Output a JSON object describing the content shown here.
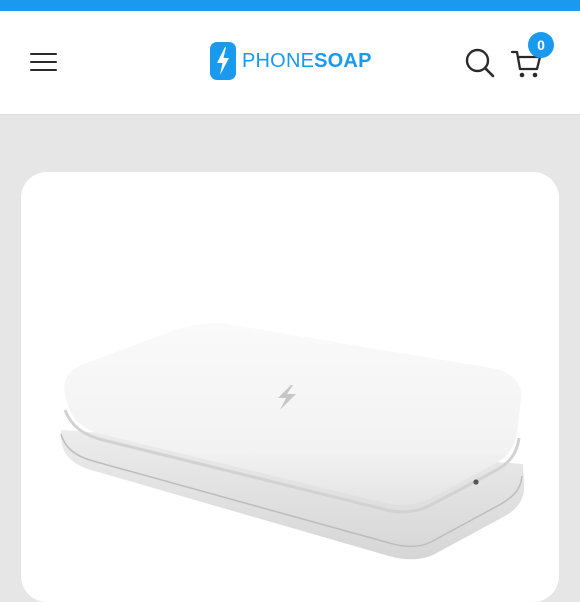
{
  "header": {
    "logo": {
      "text_light": "PHONE",
      "text_bold": "SOAP",
      "icon": "lightning-bolt-icon",
      "color": "#1a9aef"
    },
    "menu_icon": "hamburger-menu-icon",
    "search_icon": "search-icon",
    "cart_icon": "shopping-cart-icon",
    "cart_count": "0"
  },
  "product": {
    "image": "phonesoap-sanitizer-device",
    "lid_icon": "lightning-bolt-icon"
  },
  "colors": {
    "accent": "#1a9aef",
    "page_background": "#e6e6e6"
  }
}
